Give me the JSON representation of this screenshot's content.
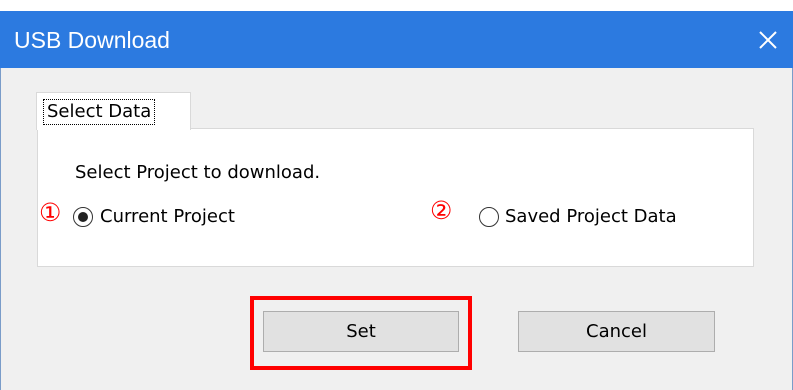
{
  "window": {
    "title": "USB Download",
    "close_icon": "close-icon"
  },
  "tabs": [
    {
      "label": "Select Data",
      "selected": true
    }
  ],
  "main": {
    "prompt": "Select Project to download.",
    "options": [
      {
        "marker": "①",
        "label": "Current Project",
        "selected": true
      },
      {
        "marker": "②",
        "label": "Saved Project Data",
        "selected": false
      }
    ]
  },
  "buttons": {
    "set_label": "Set",
    "cancel_label": "Cancel"
  },
  "colors": {
    "titlebar": "#2c7ae0",
    "annotation": "#ff0000",
    "client_bg": "#f0f0f0"
  }
}
